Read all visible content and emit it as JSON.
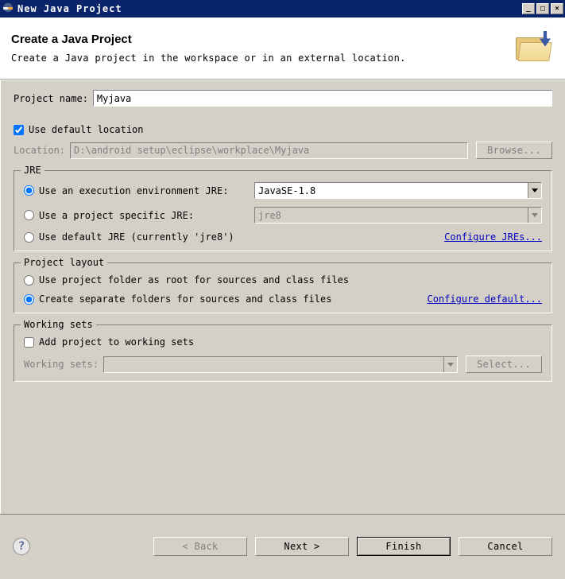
{
  "window": {
    "title": "New Java Project"
  },
  "header": {
    "title": "Create a Java Project",
    "description": "Create a Java project in the workspace or in an external location."
  },
  "form": {
    "project_name_label": "Project name:",
    "project_name_value": "Myjava",
    "use_default_location_label": "Use default location",
    "use_default_location_checked": true,
    "location_label": "Location:",
    "location_value": "D:\\android setup\\eclipse\\workplace\\Myjava",
    "browse_button": "Browse..."
  },
  "jre": {
    "legend": "JRE",
    "exec_env_label": "Use an execution environment JRE:",
    "exec_env_value": "JavaSE-1.8",
    "project_specific_label": "Use a project specific JRE:",
    "project_specific_value": "jre8",
    "default_jre_label": "Use default JRE (currently 'jre8')",
    "configure_link": "Configure JREs...",
    "selected": "exec_env"
  },
  "layout": {
    "legend": "Project layout",
    "root_label": "Use project folder as root for sources and class files",
    "separate_label": "Create separate folders for sources and class files",
    "configure_link": "Configure default...",
    "selected": "separate"
  },
  "working_sets": {
    "legend": "Working sets",
    "add_label": "Add project to working sets",
    "add_checked": false,
    "ws_label": "Working sets:",
    "select_button": "Select..."
  },
  "footer": {
    "back": "< Back",
    "next": "Next >",
    "finish": "Finish",
    "cancel": "Cancel"
  }
}
